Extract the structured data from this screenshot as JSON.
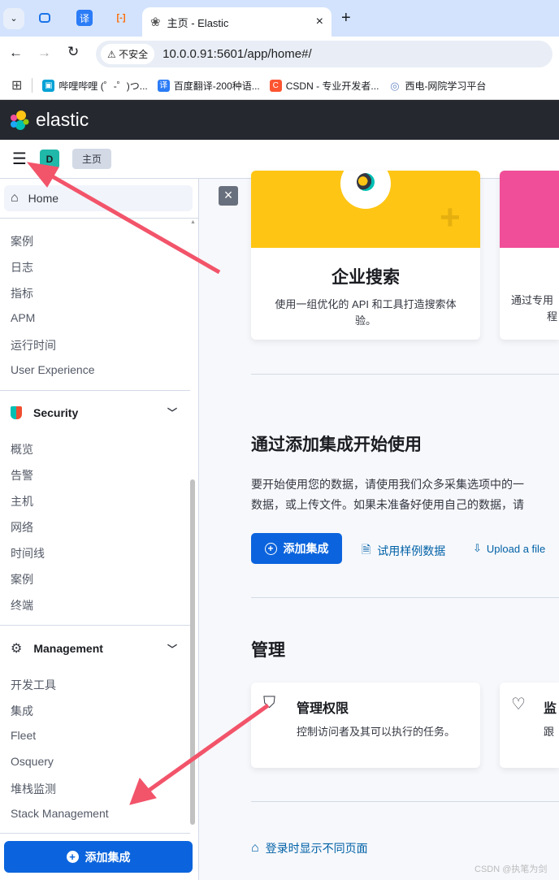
{
  "browser": {
    "tabs": [
      {
        "icon": "chrome-tab-icon"
      },
      {
        "icon": "translate-icon",
        "glyph": "译"
      },
      {
        "icon": "aliyun-icon",
        "glyph": "[-]"
      }
    ],
    "active_tab": {
      "title": "主页 - Elastic",
      "close": "×"
    },
    "new_tab": "+",
    "insecure_label": "不安全",
    "url": "10.0.0.91:5601/app/home#/",
    "bookmarks": [
      {
        "label": "哔哩哔哩 (゜-゜)つ...",
        "color": "#00a1d6",
        "glyph": "▣"
      },
      {
        "label": "百度翻译-200种语...",
        "color": "#2b7cf6",
        "glyph": "译"
      },
      {
        "label": "CSDN - 专业开发者...",
        "color": "#fc5531",
        "glyph": "C"
      },
      {
        "label": "西电-网院学习平台",
        "color": "#6b8bc4",
        "glyph": "◎"
      }
    ]
  },
  "header": {
    "brand": "elastic",
    "avatar": "D",
    "avatar_color": "#20b8a8",
    "breadcrumb": "主页"
  },
  "sidebar": {
    "home": "Home",
    "observability_items": [
      "案例",
      "日志",
      "指标",
      "APM",
      "运行时间",
      "User Experience"
    ],
    "security": {
      "title": "Security",
      "items": [
        "概览",
        "告警",
        "主机",
        "网络",
        "时间线",
        "案例",
        "终端"
      ]
    },
    "management": {
      "title": "Management",
      "items": [
        "开发工具",
        "集成",
        "Fleet",
        "Osquery",
        "堆栈监测",
        "Stack Management"
      ]
    },
    "add_integration": "添加集成"
  },
  "main": {
    "close": "×",
    "solution_cards": [
      {
        "title": "企业搜索",
        "desc": "使用一组优化的 API 和工具打造搜索体验。",
        "color": "#fec514"
      },
      {
        "title": "",
        "desc": "通过专用",
        "desc2": "程",
        "color": "#f04e98"
      }
    ],
    "integrations": {
      "title": "通过添加集成开始使用",
      "desc1": "要开始使用您的数据，请使用我们众多采集选项中的一",
      "desc2": "数据，或上传文件。如果未准备好使用自己的数据，请",
      "add_button": "添加集成",
      "sample_link": "试用样例数据",
      "upload_link": "Upload a file"
    },
    "management": {
      "title": "管理",
      "cards": [
        {
          "title": "管理权限",
          "desc": "控制访问者及其可以执行的任务。",
          "icon": "shield-icon"
        },
        {
          "title": "监",
          "desc": "跟",
          "icon": "heartbeat-icon"
        }
      ]
    },
    "default_route_link": "登录时显示不同页面"
  },
  "watermark": "CSDN @执笔为剑",
  "colors": {
    "accent": "#0b64dd",
    "annotation": "#f2546a"
  }
}
